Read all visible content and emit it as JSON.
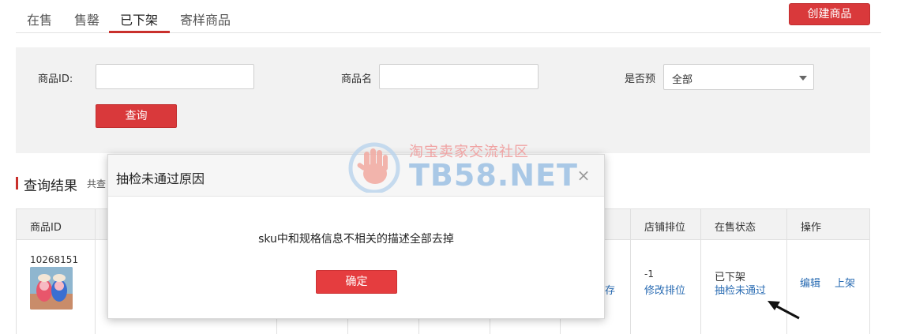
{
  "tabs": [
    {
      "label": "在售",
      "active": false
    },
    {
      "label": "售罄",
      "active": false
    },
    {
      "label": "已下架",
      "active": true
    },
    {
      "label": "寄样商品",
      "active": false
    }
  ],
  "create_button": "创建商品",
  "filter": {
    "id_label": "商品ID:",
    "name_label": "商品名",
    "preorder_label": "是否预",
    "preorder_value": "全部",
    "query_button": "查询"
  },
  "results": {
    "title": "查询结果",
    "count_prefix": "共查"
  },
  "table": {
    "headers": {
      "product_id": "商品ID",
      "store_rank": "店铺排位",
      "status": "在售状态",
      "actions": "操作"
    },
    "rows": [
      {
        "product_id": "10268151",
        "partial_stock": "存",
        "rank": "-1",
        "rank_link": "修改排位",
        "status": "已下架",
        "status_link": "抽检未通过",
        "edit": "编辑",
        "shelve": "上架"
      }
    ]
  },
  "modal": {
    "title": "抽检未通过原因",
    "close_symbol": "×",
    "message": "sku中和规格信息不相关的描述全部去掉",
    "ok_button": "确定"
  },
  "watermark": {
    "cn": "淘宝卖家交流社区",
    "en": "TB58.NET"
  },
  "colors": {
    "brand_red": "#d9393b",
    "link_blue": "#2a6cb3"
  }
}
